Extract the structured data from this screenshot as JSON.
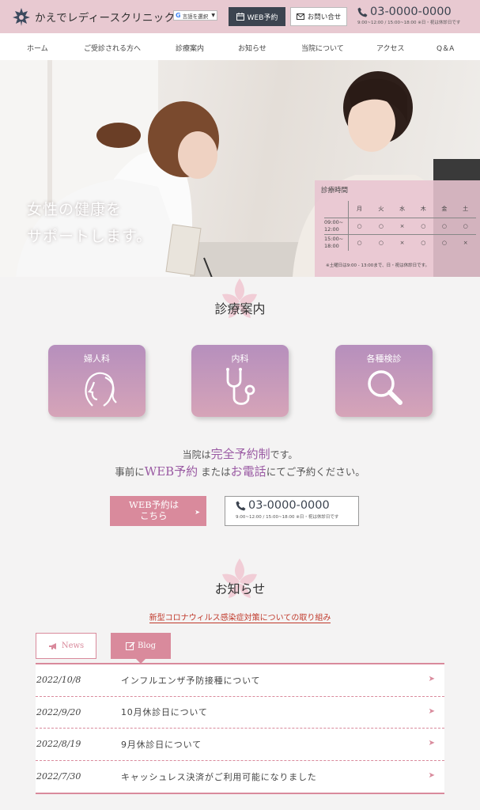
{
  "header": {
    "logo_text": "かえでレディースクリニック",
    "translate_label": "言語を選択",
    "web_reservation": "WEB予約",
    "contact": "お問い合せ",
    "phone": "03-0000-0000",
    "hours": "9:00~12:00 / 15:00~18:00  ※日・祝は休診日です"
  },
  "nav": [
    "ホーム",
    "ご受診される方へ",
    "診療案内",
    "お知らせ",
    "当院について",
    "アクセス",
    "Q＆A"
  ],
  "hero": {
    "line1": "女性の健康を",
    "line2": "サポートします。",
    "hours_title": "診療時間",
    "days": [
      "月",
      "火",
      "水",
      "木",
      "金",
      "土"
    ],
    "slots": [
      {
        "label1": "09:00~",
        "label2": "12:00",
        "marks": [
          "○",
          "○",
          "×",
          "○",
          "○",
          "○"
        ]
      },
      {
        "label1": "15:00~",
        "label2": "18:00",
        "marks": [
          "○",
          "○",
          "×",
          "○",
          "○",
          "×"
        ]
      }
    ],
    "hours_note": "※土曜日は9:00 - 13:00まで、日・祝は休診日です。"
  },
  "services": {
    "title": "診療案内",
    "cards": [
      "婦人科",
      "内科",
      "各種検診"
    ]
  },
  "notice": {
    "p1": "当院は",
    "p1_em": "完全予約制",
    "p1_end": "です。",
    "p2": "事前に",
    "p2_em1": "WEB予約",
    "p2_mid": " または",
    "p2_em2": "お電話",
    "p2_end": "にてご予約ください。"
  },
  "cta": {
    "web_line1": "WEB予約は",
    "web_line2": "こちら",
    "arrow": "➤",
    "phone": "03-0000-0000",
    "hours": "9:00~12:00 / 15:00~18:00  ※日・祝は休診日です"
  },
  "news": {
    "title": "お知らせ",
    "covid_link": "新型コロナウィルス感染症対策についての取り組み",
    "tab_news": "News",
    "tab_blog": "Blog",
    "items": [
      {
        "date": "2022/10/8",
        "title": "インフルエンザ予防接種について"
      },
      {
        "date": "2022/9/20",
        "title": "10月休診日について"
      },
      {
        "date": "2022/8/19",
        "title": "9月休診日について"
      },
      {
        "date": "2022/7/30",
        "title": "キャッシュレス決済がご利用可能になりました"
      }
    ],
    "arrow": "➤"
  },
  "colors": {
    "header_bg": "#e8c9d1",
    "accent_pink": "#d98a9c",
    "dark_navy": "#3c4450",
    "card_purple": "#b68fbd",
    "em_purple": "#9a5aa3",
    "alert_red": "#c0392b"
  }
}
